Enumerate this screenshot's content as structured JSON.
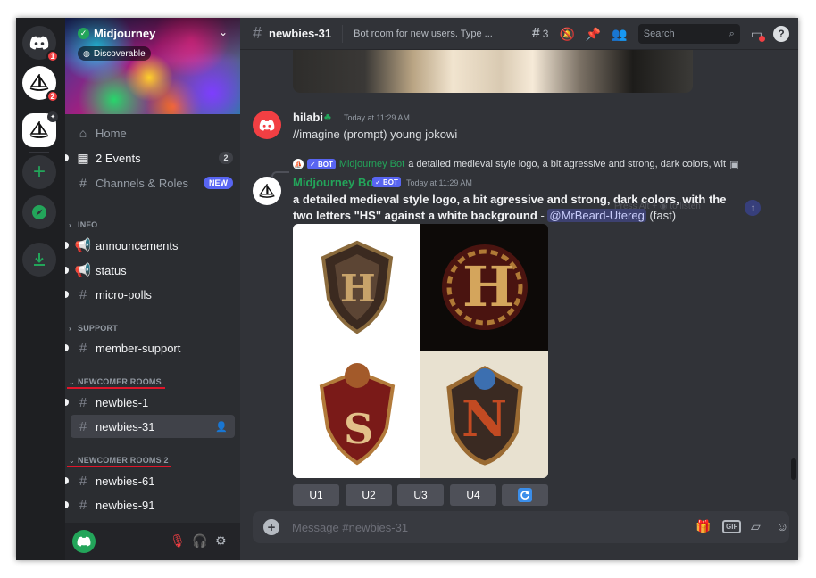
{
  "app": {
    "accent": "#5865f2",
    "online_green": "#23a55a",
    "alert_red": "#f23f43"
  },
  "server_rail": {
    "items": [
      {
        "name": "discord-home-icon",
        "badge": "1"
      },
      {
        "name": "midjourney-server-icon",
        "badge": "2"
      },
      {
        "name": "midjourney-server-icon-2",
        "badge": ""
      },
      {
        "name": "add-server-icon",
        "badge": ""
      },
      {
        "name": "explore-servers-icon",
        "badge": ""
      },
      {
        "name": "download-apps-icon",
        "badge": ""
      }
    ]
  },
  "server": {
    "name": "Midjourney",
    "discoverable_label": "Discoverable"
  },
  "sidebar": {
    "home": "Home",
    "events": "2 Events",
    "events_count": "2",
    "channels_roles": "Channels & Roles",
    "new_badge": "NEW",
    "categories": {
      "info": "INFO",
      "support": "SUPPORT",
      "newcomer": "NEWCOMER ROOMS",
      "newcomer2": "NEWCOMER ROOMS 2"
    },
    "channels": {
      "announcements": "announcements",
      "status": "status",
      "micro_polls": "micro-polls",
      "member_support": "member-support",
      "newbies_1": "newbies-1",
      "newbies_31": "newbies-31",
      "newbies_61": "newbies-61",
      "newbies_91": "newbies-91"
    }
  },
  "header": {
    "channel": "newbies-31",
    "topic": "Bot room for new users. Type ...",
    "threads_count": "3",
    "search_placeholder": "Search",
    "help": "?"
  },
  "messages": [
    {
      "author": "hilabi",
      "timestamp": "Today at 11:29 AM",
      "text": "//imagine (prompt)  young jokowi"
    },
    {
      "reply_author": "Midjourney Bot",
      "reply_text": "a detailed medieval style logo, a bit agressive and strong, dark colors, wit",
      "author": "Midjourney Bot",
      "bot_tag": "BOT",
      "timestamp": "Today at 11:29 AM",
      "prompt": "a detailed medieval style logo, a bit agressive and strong, dark colors, with the two letters \"HS\" against a white background",
      "mention": "@MrBeard-Utereg",
      "speed": "(fast)",
      "tooltip": "Press  Alt  +  ◉  to listen",
      "image_letters": [
        "H",
        "H",
        "S",
        "N"
      ]
    }
  ],
  "buttons": {
    "u1": "U1",
    "u2": "U2",
    "u3": "U3",
    "u4": "U4"
  },
  "composer": {
    "placeholder": "Message #newbies-31",
    "gif": "GIF"
  }
}
